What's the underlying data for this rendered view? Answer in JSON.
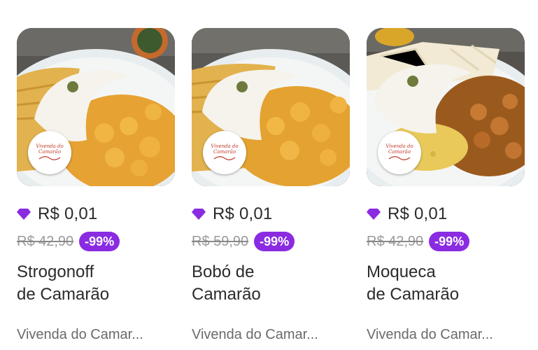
{
  "colors": {
    "accent": "#8a2be2",
    "price_text": "#2b2b2b",
    "old_price_text": "#9b9b9b",
    "store_text": "#6a6a6a"
  },
  "products": [
    {
      "name": "Strogonoff\nde Camarão",
      "price": "R$ 0,01",
      "old_price": "R$ 42,90",
      "discount": "-99%",
      "store": "Vivenda do Camar...",
      "logo_text": "Vivenda do Camarão",
      "icon": "gem-icon"
    },
    {
      "name": "Bobó de\nCamarão",
      "price": "R$ 0,01",
      "old_price": "R$ 59,90",
      "discount": "-99%",
      "store": "Vivenda do Camar...",
      "logo_text": "Vivenda do Camarão",
      "icon": "gem-icon"
    },
    {
      "name": "Moqueca\nde Camarão",
      "price": "R$ 0,01",
      "old_price": "R$ 42,90",
      "discount": "-99%",
      "store": "Vivenda do Camar...",
      "logo_text": "Vivenda do Camarão",
      "icon": "gem-icon"
    }
  ]
}
